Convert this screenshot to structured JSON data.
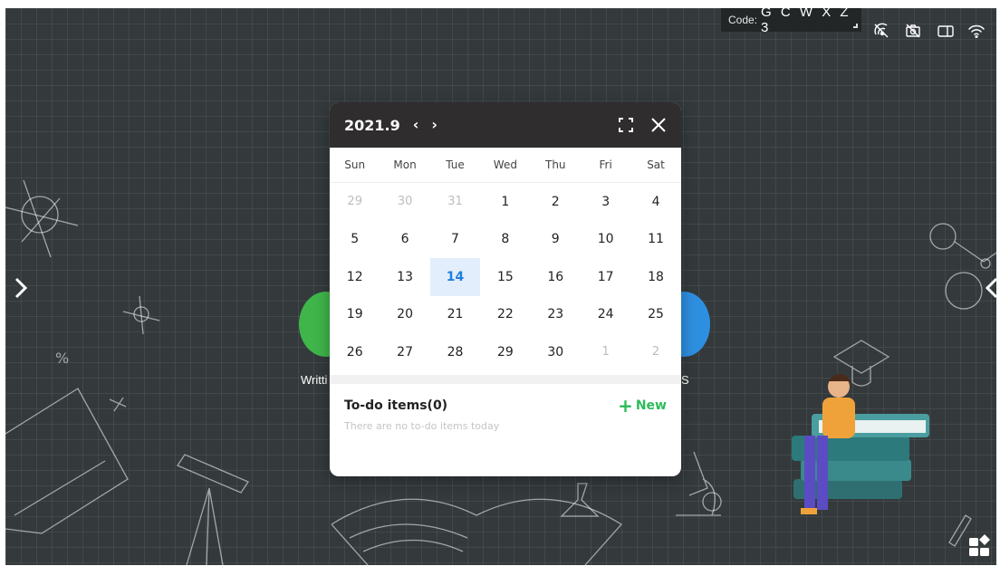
{
  "status_bar": {
    "code_label": "Code:",
    "code_value": "G C W X Z 3",
    "icons": [
      "screen-cast-off-icon",
      "camera-off-icon",
      "window-icon",
      "wifi-icon"
    ]
  },
  "background_apps": {
    "left_label": "Writti",
    "right_label": "S"
  },
  "calendar": {
    "month_label": "2021.9",
    "prev_label": "‹",
    "next_label": "›",
    "weekdays": [
      "Sun",
      "Mon",
      "Tue",
      "Wed",
      "Thu",
      "Fri",
      "Sat"
    ],
    "weeks": [
      [
        "29",
        "30",
        "31",
        "1",
        "2",
        "3",
        "4"
      ],
      [
        "5",
        "6",
        "7",
        "8",
        "9",
        "10",
        "11"
      ],
      [
        "12",
        "13",
        "14",
        "15",
        "16",
        "17",
        "18"
      ],
      [
        "19",
        "20",
        "21",
        "22",
        "23",
        "24",
        "25"
      ],
      [
        "26",
        "27",
        "28",
        "29",
        "30",
        "1",
        "2"
      ]
    ],
    "today": "14",
    "todo_title": "To-do items(0)",
    "new_plus": "+",
    "new_label": "New",
    "empty_text": "There are no to-do items today"
  },
  "colors": {
    "board": "#343a3c",
    "header": "#2f2d2e",
    "today_bg": "#e2eefb",
    "today_text": "#1f7fe0",
    "new_green": "#2dbb5c",
    "writing_app": "#3fb54a",
    "blue_app": "#2e8fe0"
  }
}
